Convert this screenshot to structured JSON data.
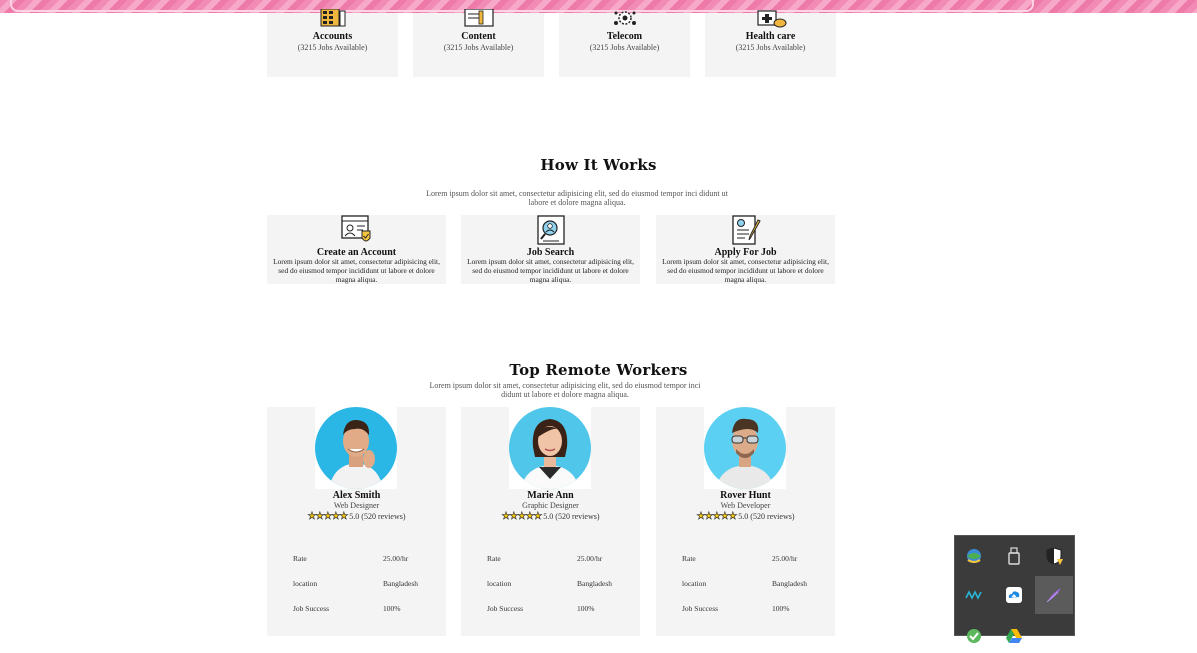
{
  "categories": [
    {
      "title": "Accounts",
      "sub": "(3215 Jobs Available)",
      "icon": "calculator-icon"
    },
    {
      "title": "Content",
      "sub": "(3215 Jobs Available)",
      "icon": "document-pen-icon"
    },
    {
      "title": "Telecom",
      "sub": "(3215 Jobs Available)",
      "icon": "network-gear-icon"
    },
    {
      "title": "Health care",
      "sub": "(3215 Jobs Available)",
      "icon": "medical-kit-icon"
    }
  ],
  "how": {
    "title": "How It Works",
    "desc": "Lorem ipsum dolor sit amet, consectetur adipisicing elit, sed do eiusmod tempor inci didunt ut labore et dolore magna aliqua.",
    "steps": [
      {
        "title": "Create an Account",
        "text": "Lorem ipsum dolor sit amet, consectetur adipisicing elit, sed do eiusmod tempor incididunt ut labore et dolore magna aliqua.",
        "icon": "account-shield-icon"
      },
      {
        "title": "Job Search",
        "text": "Lorem ipsum dolor sit amet, consectetur adipisicing elit, sed do eiusmod tempor incididunt ut labore et dolore magna aliqua.",
        "icon": "profile-search-icon"
      },
      {
        "title": "Apply For Job",
        "text": "Lorem ipsum dolor sit amet, consectetur adipisicing elit, sed do eiusmod tempor incididunt ut labore et dolore magna aliqua.",
        "icon": "resume-pen-icon"
      }
    ]
  },
  "workers": {
    "title": "Top Remote Workers",
    "desc": "Lorem ipsum dolor sit amet, consectetur adipisicing elit, sed do eiusmod tempor inci didunt ut labore et dolore magna aliqua.",
    "labels": {
      "rate": "Rate",
      "location": "location",
      "success": "Job Success"
    },
    "items": [
      {
        "name": "Alex Smith",
        "role": "Web Designer",
        "rating": "5.0 (520 reviews)",
        "rate": "25.00/hr",
        "location": "Bangladesh",
        "success": "100%"
      },
      {
        "name": "Marie Ann",
        "role": "Graphic Designer",
        "rating": "5.0 (520 reviews)",
        "rate": "25.00/hr",
        "location": "Bangladesh",
        "success": "100%"
      },
      {
        "name": "Rover Hunt",
        "role": "Web Developer",
        "rating": "5.0 (520 reviews)",
        "rate": "25.00/hr",
        "location": "Bangladesh",
        "success": "100%"
      }
    ]
  },
  "tray": {
    "icons": [
      "globe-sync-icon",
      "usb-drive-icon",
      "security-shield-warning-icon",
      "network-wave-icon",
      "cloud-upload-icon",
      "feather-pen-icon",
      "check-shield-icon",
      "google-drive-icon"
    ]
  }
}
